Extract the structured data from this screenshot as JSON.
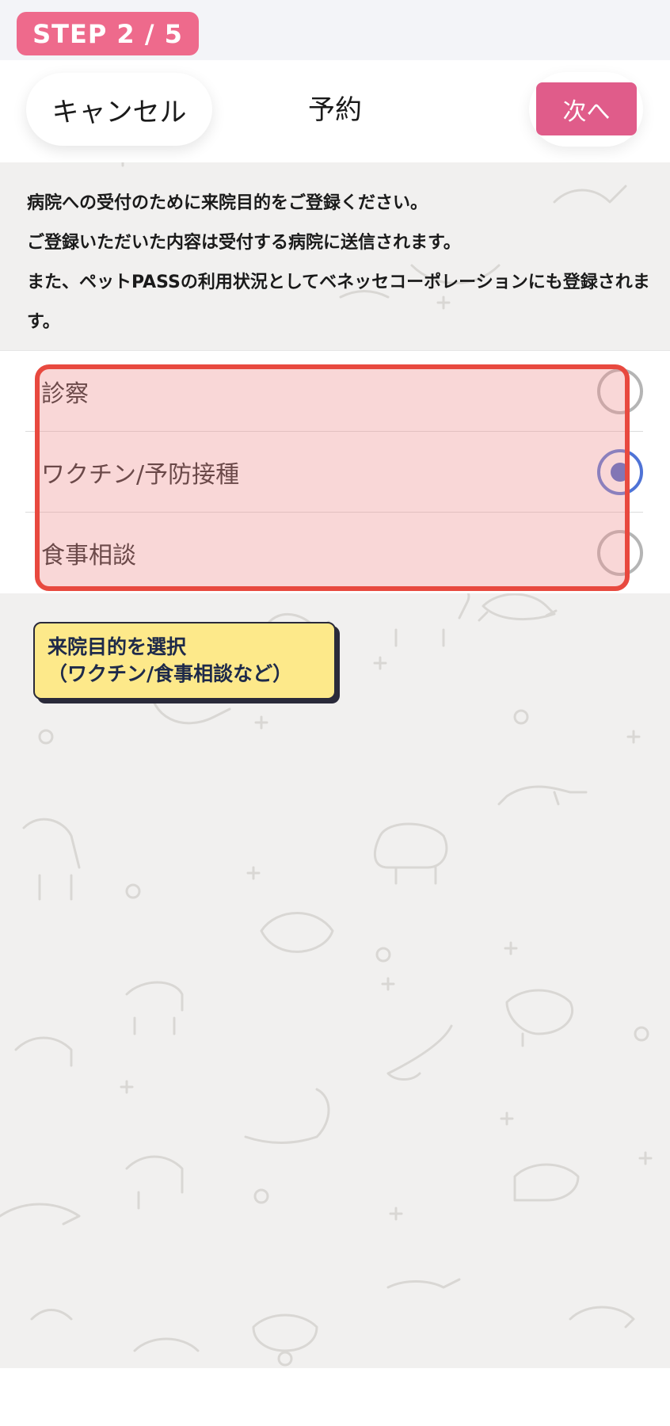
{
  "step": {
    "label": "STEP 2 / 5"
  },
  "header": {
    "cancel_label": "キャンセル",
    "title": "予約",
    "next_label": "次へ"
  },
  "description": {
    "lines": [
      "病院への受付のために来院目的をご登録ください。",
      "ご登録いただいた内容は受付する病院に送信されます。",
      "また、ペットPASSの利用状況としてベネッセコーポレーションにも登録されます。"
    ]
  },
  "options": [
    {
      "label": "診察",
      "selected": false
    },
    {
      "label": "ワクチン/予防接種",
      "selected": true
    },
    {
      "label": "食事相談",
      "selected": false
    }
  ],
  "callout": {
    "line1": "来院目的を選択",
    "line2": "（ワクチン/食事相談など）"
  },
  "colors": {
    "step_badge": "#ee6a8c",
    "next_button": "#e05c8a",
    "highlight_border": "#e8493f",
    "radio_selected": "#3f63c9",
    "callout_bg": "#fde98a"
  }
}
